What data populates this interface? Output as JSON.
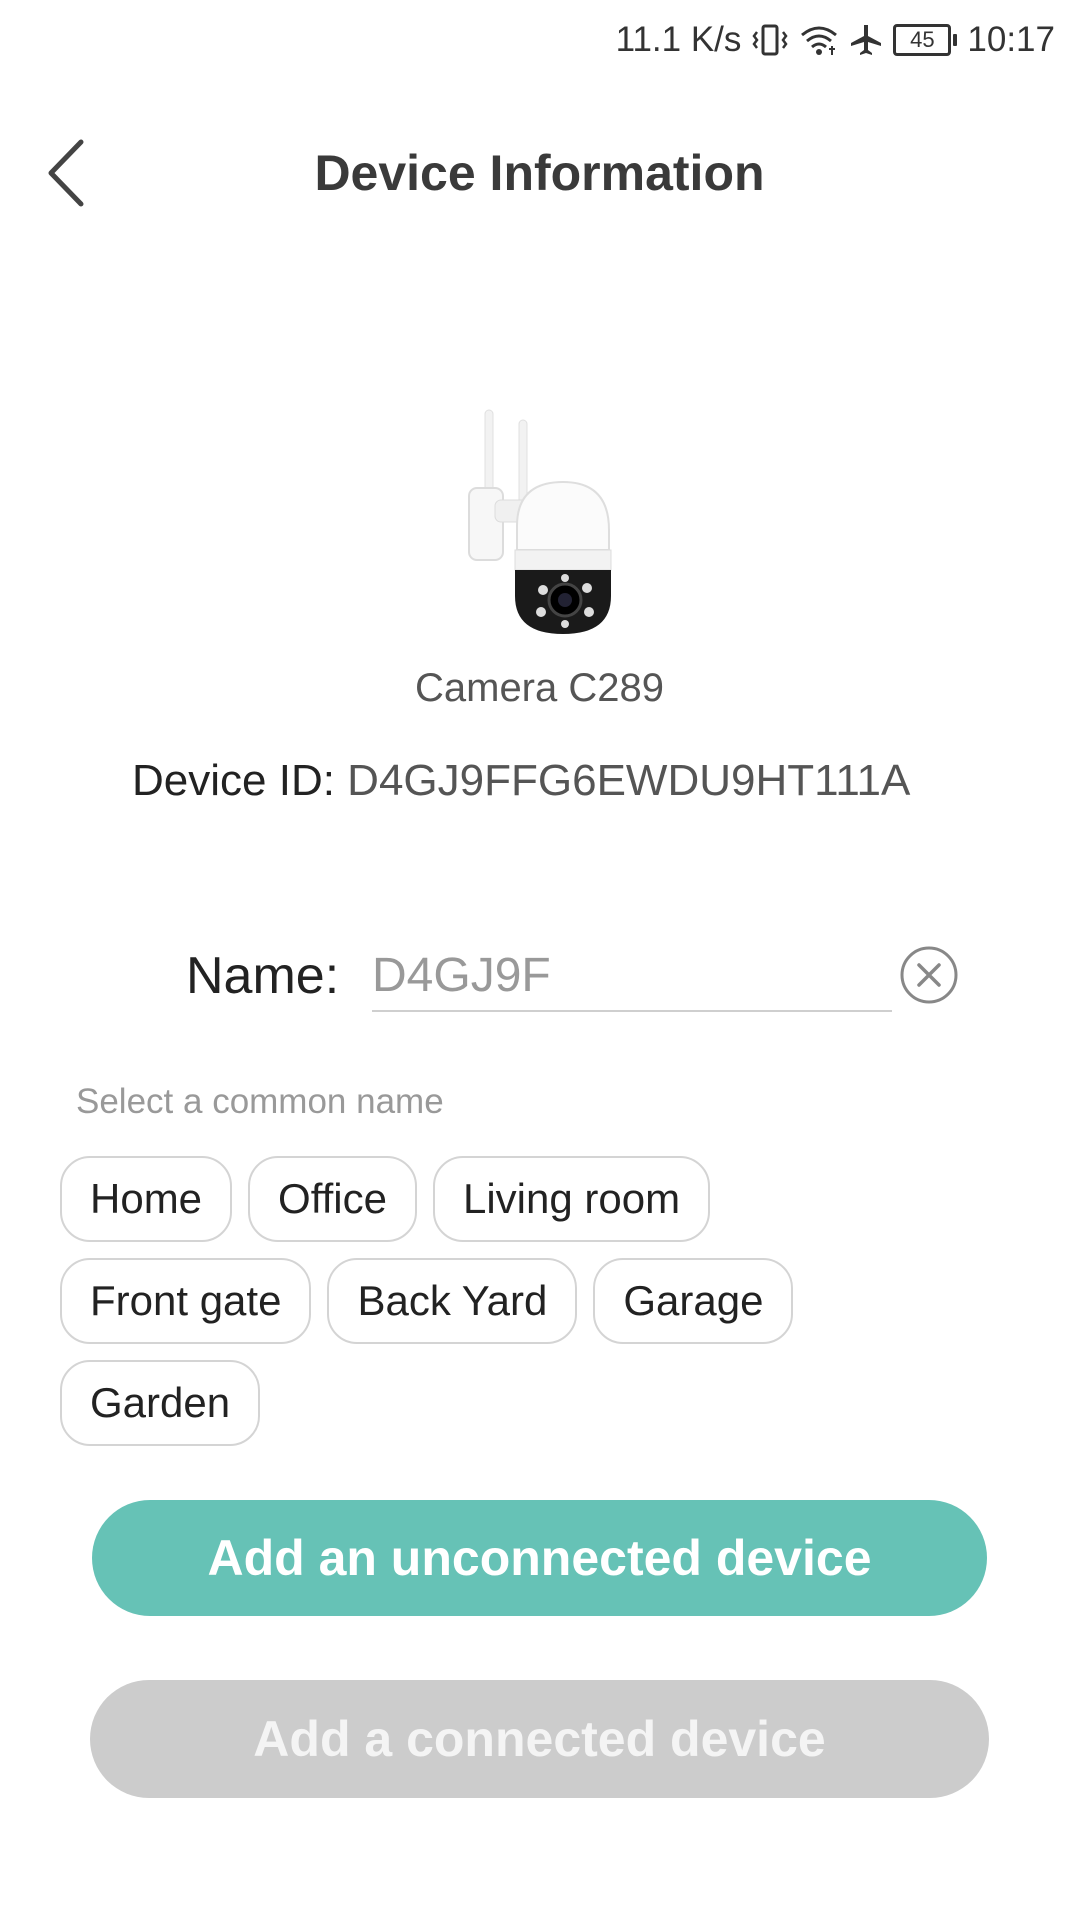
{
  "status_bar": {
    "network_speed": "11.1 K/s",
    "battery_level": "45",
    "time": "10:17",
    "icons": [
      "vibrate-icon",
      "wifi-icon",
      "airplane-icon",
      "battery-icon"
    ]
  },
  "header": {
    "title": "Device Information",
    "back_icon": "chevron-left-icon"
  },
  "device": {
    "model": "Camera C289",
    "id_label": "Device ID",
    "id_separator": ":",
    "id_value": " D4GJ9FFG6EWDU9HT111A"
  },
  "name_field": {
    "label": "Name:",
    "placeholder": "D4GJ9F",
    "value": "",
    "clear_icon": "clear-circle-icon"
  },
  "common_names": {
    "hint": "Select a common name",
    "rows": [
      [
        "Home",
        "Office",
        "Living room"
      ],
      [
        "Front gate",
        "Back Yard",
        "Garage"
      ],
      [
        "Garden"
      ]
    ]
  },
  "actions": {
    "primary_label": "Add an unconnected device",
    "secondary_label": "Add a connected device",
    "primary_color": "#66c2b6",
    "secondary_color": "#cccccc"
  }
}
